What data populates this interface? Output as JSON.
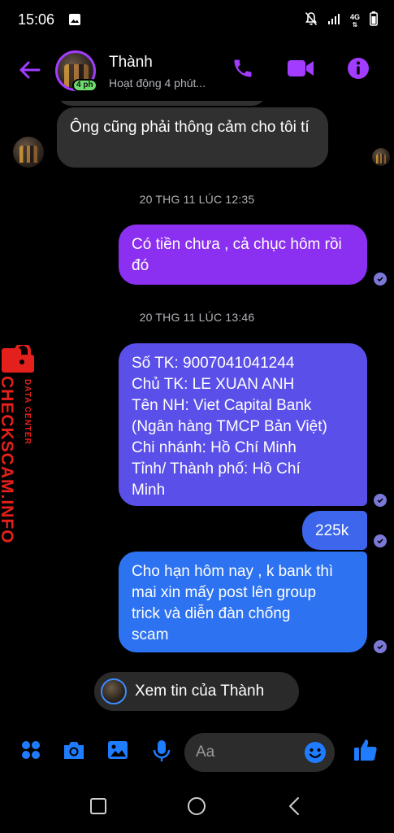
{
  "status_bar": {
    "time": "15:06",
    "network": "4G"
  },
  "header": {
    "contact_name": "Thành",
    "active_status": "Hoạt động 4 phút...",
    "avatar_badge": "4 ph"
  },
  "messages": [
    {
      "direction": "incoming",
      "text": "Ông cũng phải thông cảm cho tôi tí"
    },
    {
      "type": "timestamp",
      "text": "20 THG 11 LÚC 12:35"
    },
    {
      "direction": "outgoing",
      "text": "Có tiền chưa , cả chục hôm rồi đó"
    },
    {
      "type": "timestamp",
      "text": "20 THG 11 LÚC 13:46"
    },
    {
      "direction": "outgoing",
      "lines": [
        "Số TK: 9007041041244",
        "Chủ TK: LE XUAN ANH",
        "Tên NH: Viet Capital Bank",
        "(Ngân hàng TMCP Bản Việt)",
        "Chi nhánh: Hồ Chí Minh",
        "Tỉnh/ Thành phố: Hồ Chí",
        "Minh"
      ]
    },
    {
      "direction": "outgoing",
      "text": "225k"
    },
    {
      "direction": "outgoing",
      "lines": [
        "Cho hạn hôm nay , k bank thì",
        "mai xin mấy post lên group",
        "trick và diễn đàn chống",
        "scam"
      ]
    }
  ],
  "watermark": {
    "main": "CHECKSCAM.INFO",
    "sub": "DATA CENTER"
  },
  "story_prompt": "Xem tin của Thành",
  "composer": {
    "placeholder": "Aa"
  },
  "colors": {
    "accent_purple": "#a23cff",
    "bubble_in": "#303030",
    "bubble_out_top": "#8b2ff0",
    "bubble_out_mid": "#5b4ee6",
    "bubble_out_bottom": "#2d72f0",
    "icon_blue": "#1f7cff",
    "watermark_red": "#e3201b"
  }
}
